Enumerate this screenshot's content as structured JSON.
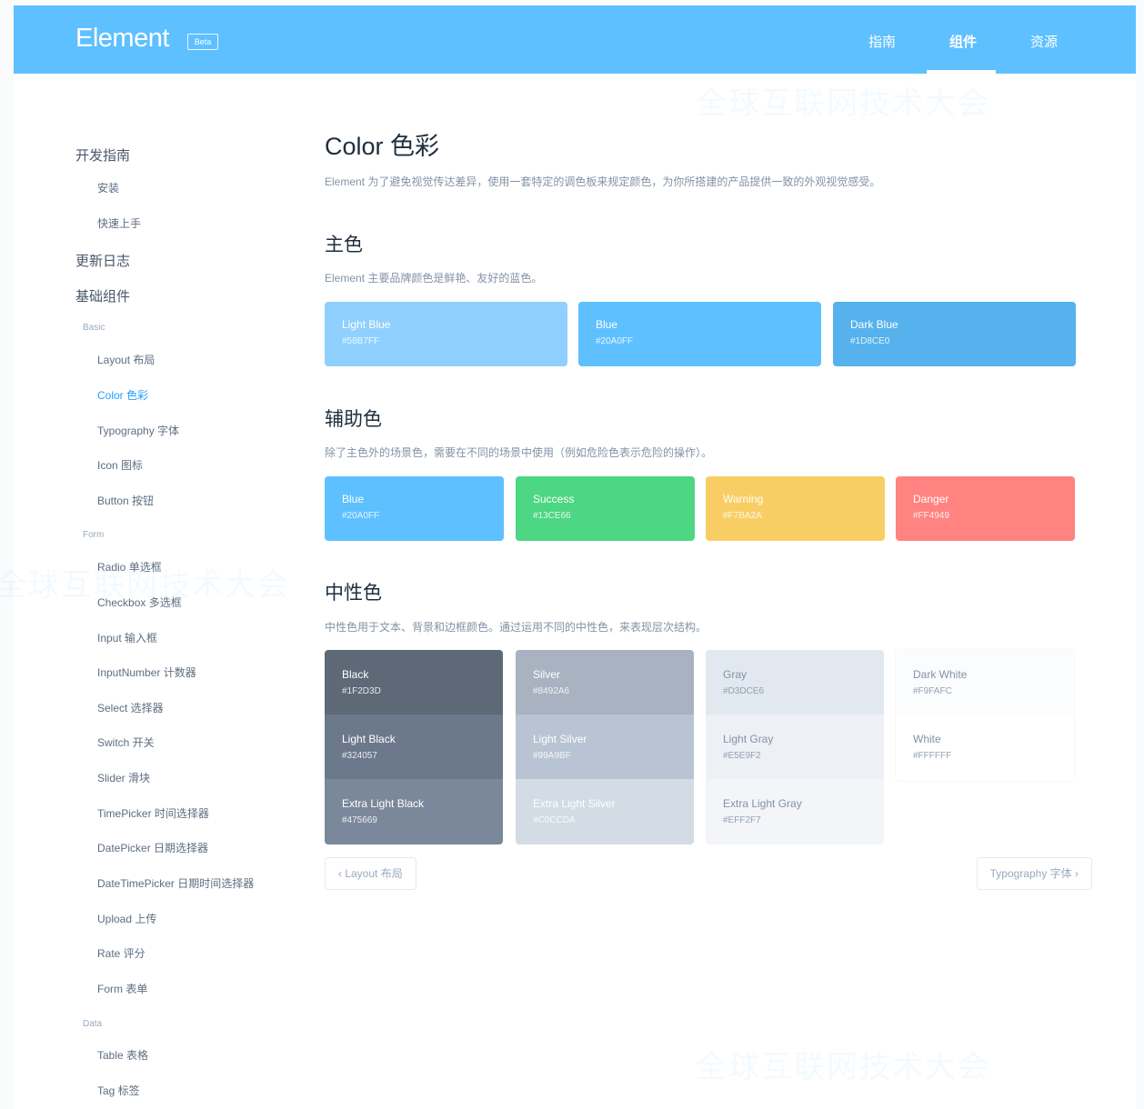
{
  "header": {
    "logo": "Element",
    "badge": "Beta",
    "nav": [
      {
        "label": "指南"
      },
      {
        "label": "组件"
      },
      {
        "label": "资源"
      }
    ]
  },
  "sidebar": {
    "items": [
      {
        "label": "开发指南",
        "kind": "heading"
      },
      {
        "label": "安装",
        "kind": "item"
      },
      {
        "label": "快速上手",
        "kind": "item"
      },
      {
        "label": "更新日志",
        "kind": "heading"
      },
      {
        "label": "基础组件",
        "kind": "heading"
      },
      {
        "label": "Basic",
        "kind": "group"
      },
      {
        "label": "Layout 布局",
        "kind": "item"
      },
      {
        "label": "Color 色彩",
        "kind": "item",
        "active": true
      },
      {
        "label": "Typography 字体",
        "kind": "item"
      },
      {
        "label": "Icon 图标",
        "kind": "item"
      },
      {
        "label": "Button 按钮",
        "kind": "item"
      },
      {
        "label": "Form",
        "kind": "group"
      },
      {
        "label": "Radio 单选框",
        "kind": "item"
      },
      {
        "label": "Checkbox 多选框",
        "kind": "item"
      },
      {
        "label": "Input 输入框",
        "kind": "item"
      },
      {
        "label": "InputNumber 计数器",
        "kind": "item"
      },
      {
        "label": "Select 选择器",
        "kind": "item"
      },
      {
        "label": "Switch 开关",
        "kind": "item"
      },
      {
        "label": "Slider 滑块",
        "kind": "item"
      },
      {
        "label": "TimePicker 时间选择器",
        "kind": "item"
      },
      {
        "label": "DatePicker 日期选择器",
        "kind": "item"
      },
      {
        "label": "DateTimePicker 日期时间选择器",
        "kind": "item"
      },
      {
        "label": "Upload 上传",
        "kind": "item"
      },
      {
        "label": "Rate 评分",
        "kind": "item"
      },
      {
        "label": "Form 表单",
        "kind": "item"
      },
      {
        "label": "Data",
        "kind": "group"
      },
      {
        "label": "Table 表格",
        "kind": "item"
      },
      {
        "label": "Tag 标签",
        "kind": "item"
      }
    ]
  },
  "main": {
    "title": "Color 色彩",
    "intro": "Element 为了避免视觉传达差异，使用一套特定的调色板来规定颜色，为你所搭建的产品提供一致的外观视觉感受。",
    "primary": {
      "title": "主色",
      "desc": "Element 主要品牌颜色是鲜艳、友好的蓝色。",
      "swatches": [
        {
          "name": "Light Blue",
          "hex": "#58B7FF",
          "color": "#8fd0ff"
        },
        {
          "name": "Blue",
          "hex": "#20A0FF",
          "color": "#5ec0ff"
        },
        {
          "name": "Dark Blue",
          "hex": "#1D8CE0",
          "color": "#55b2ec"
        }
      ]
    },
    "secondary": {
      "title": "辅助色",
      "desc": "除了主色外的场景色，需要在不同的场景中使用（例如危险色表示危险的操作）。",
      "swatches": [
        {
          "name": "Blue",
          "hex": "#20A0FF",
          "color": "#5ec0ff"
        },
        {
          "name": "Success",
          "hex": "#13CE66",
          "color": "#4dd683"
        },
        {
          "name": "Warning",
          "hex": "#F7BA2A",
          "color": "#f8ce64"
        },
        {
          "name": "Danger",
          "hex": "#FF4949",
          "color": "#ff8380"
        }
      ]
    },
    "neutral": {
      "title": "中性色",
      "desc": "中性色用于文本、背景和边框颜色。通过运用不同的中性色，来表现层次结构。",
      "columns": [
        {
          "cells": [
            {
              "name": "Black",
              "hex": "#1F2D3D",
              "color": "#5d6977"
            },
            {
              "name": "Light Black",
              "hex": "#324057",
              "color": "#6c798c"
            },
            {
              "name": "Extra Light Black",
              "hex": "#475669",
              "color": "#7b889b"
            }
          ]
        },
        {
          "cells": [
            {
              "name": "Silver",
              "hex": "#8492A6",
              "color": "#a8b2c0"
            },
            {
              "name": "Light Silver",
              "hex": "#99A9BF",
              "color": "#b8c4d3"
            },
            {
              "name": "Extra Light Silver",
              "hex": "#C0CCDA",
              "color": "#d3dbe5"
            }
          ]
        },
        {
          "cells": [
            {
              "name": "Gray",
              "hex": "#D3DCE6",
              "color": "#e2e8ef"
            },
            {
              "name": "Light Gray",
              "hex": "#E5E9F2",
              "color": "#edf0f5"
            },
            {
              "name": "Extra Light Gray",
              "hex": "#EFF2F7",
              "color": "#f3f5f9"
            }
          ]
        },
        {
          "cells": [
            {
              "name": "Dark White",
              "hex": "#F9FAFC",
              "color": "#fbfcfd"
            },
            {
              "name": "White",
              "hex": "#FFFFFF",
              "color": "#ffffff"
            }
          ]
        }
      ]
    },
    "pager": {
      "prev": "‹  Layout 布局",
      "next": "Typography 字体  ›"
    }
  },
  "watermark": {
    "text": "全球互联网技术大会"
  }
}
